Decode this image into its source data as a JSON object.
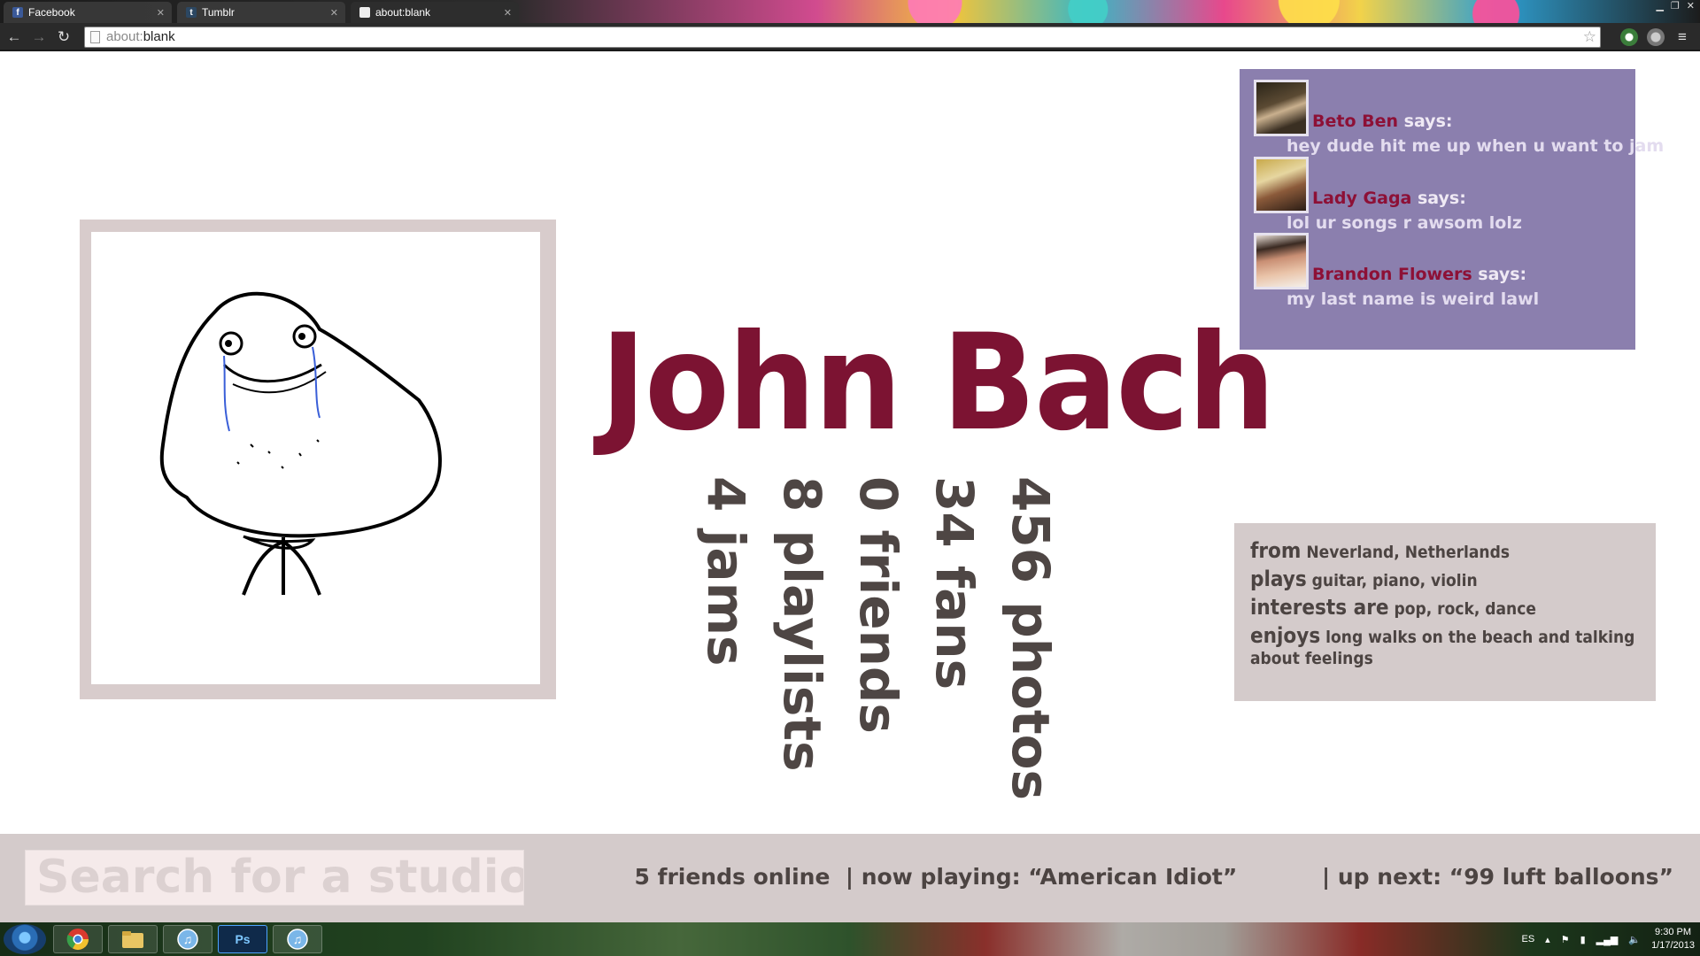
{
  "browser": {
    "tabs": [
      {
        "label": "Facebook",
        "icon": "facebook-icon"
      },
      {
        "label": "Tumblr",
        "icon": "tumblr-icon"
      },
      {
        "label": "about:blank",
        "icon": "page-icon",
        "active": true
      }
    ],
    "url_dim": "about:",
    "url_main": "blank"
  },
  "profile": {
    "name": "John Bach",
    "stats": [
      "456 photos",
      "34 fans",
      "0 friends",
      "8 playlists",
      "4 jams"
    ]
  },
  "comments": [
    {
      "author": "Beto Ben",
      "says": "says:",
      "text": "hey dude hit me up when u want to jam",
      "avatar": "beethoven"
    },
    {
      "author": "Lady Gaga",
      "says": "says:",
      "text": "lol ur songs r awsom lolz",
      "avatar": "lady-gaga"
    },
    {
      "author": "Brandon Flowers",
      "says": "says:",
      "text": "my last name is weird lawl",
      "avatar": "brandon-flowers"
    }
  ],
  "about": {
    "from_key": "from",
    "from_val": "Neverland, Netherlands",
    "plays_key": "plays",
    "plays_val": "guitar, piano, violin",
    "interests_key": "interests are",
    "interests_val": "pop, rock, dance",
    "enjoys_key": "enjoys",
    "enjoys_val": "long walks on the beach and talking",
    "enjoys_cont": "about feelings"
  },
  "bottom": {
    "search_placeholder": "Search for a studio",
    "friends_online": "5 friends online",
    "now_playing": "|  now playing: “American Idiot”",
    "up_next": "|  up next: “99 luft balloons”"
  },
  "taskbar": {
    "lang": "ES",
    "time": "9:30 PM",
    "date": "1/17/2013",
    "ps_label": "Ps"
  },
  "colors": {
    "name": "#7c1332",
    "panel_purple": "#8b7fae",
    "panel_rose": "#d4cbcb",
    "stat_text": "#4e4644"
  }
}
